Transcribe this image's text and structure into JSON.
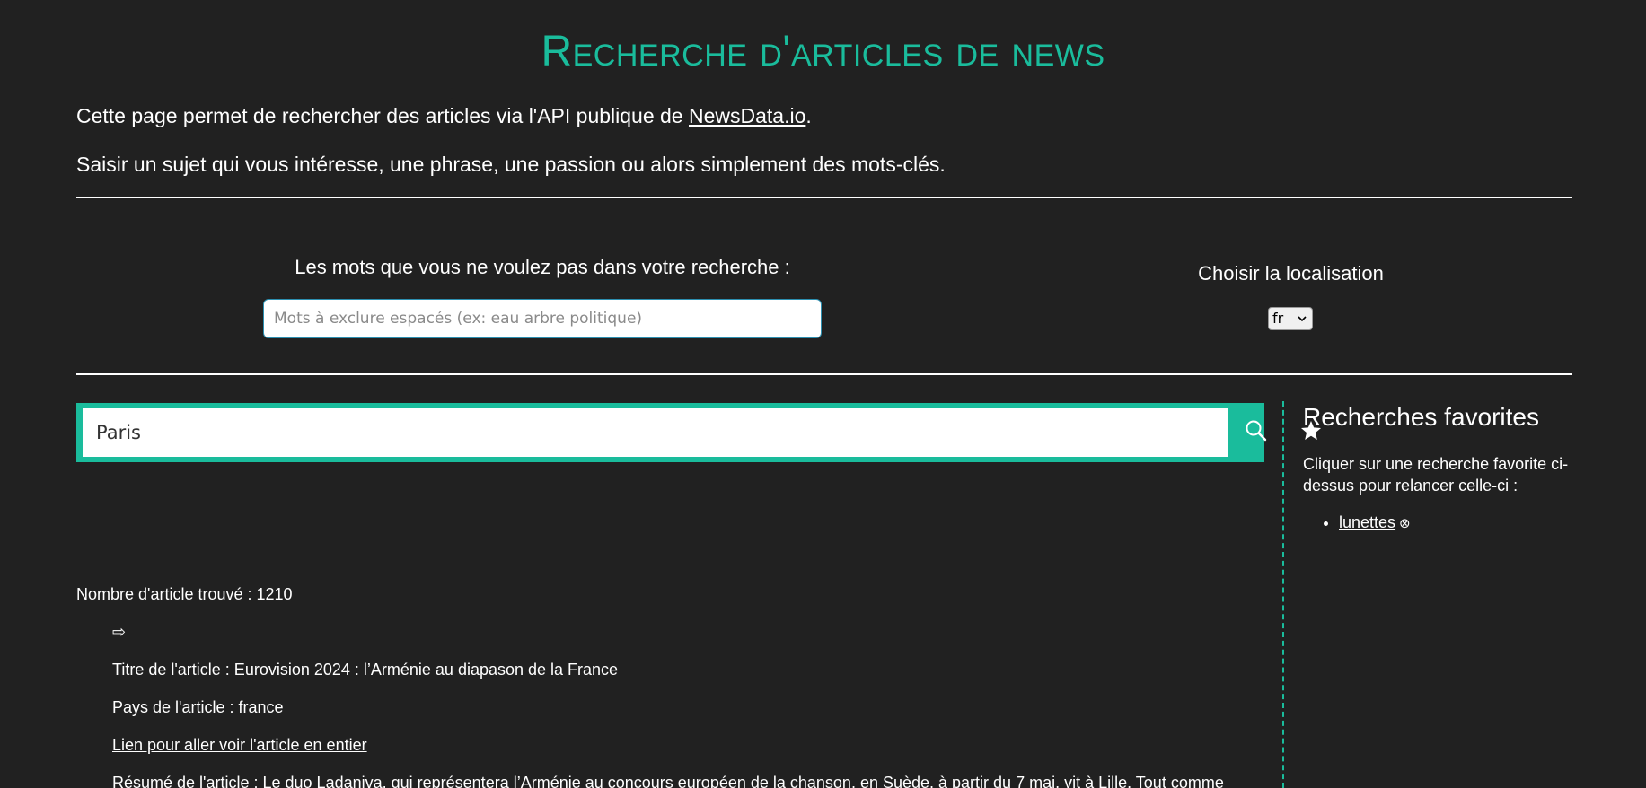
{
  "header": {
    "title": "Recherche d'articles de news"
  },
  "intro": {
    "line1_prefix": "Cette page permet de rechercher des articles via l'API publique de ",
    "line1_link": "NewsData.io",
    "line1_suffix": ".",
    "line2": "Saisir un sujet qui vous intéresse, une phrase, une passion ou alors simplement des mots-clés."
  },
  "filters": {
    "exclude_label": "Les mots que vous ne voulez pas dans votre recherche :",
    "exclude_placeholder": "Mots à exclure espacés (ex: eau arbre politique)",
    "exclude_value": "",
    "location_label": "Choisir la localisation",
    "location_value": "fr"
  },
  "search": {
    "value": "Paris",
    "search_icon": "search-icon",
    "favorite_icon": "star-icon"
  },
  "results": {
    "count_label": "Nombre d'article trouvé : 1210",
    "articles": [
      {
        "arrow": "⇨",
        "title": "Titre de l'article : Eurovision 2024 : l’Arménie au diapason de la France",
        "country": "Pays de l'article : france",
        "link_label": "Lien pour aller voir l'article en entier",
        "summary": "Résumé de l'article : Le duo Ladaniva, qui représentera l’Arménie au concours européen de la chanson, en Suède, à partir du 7 mai, vit à Lille. Tout comme"
      }
    ]
  },
  "favorites": {
    "title": "Recherches favorites",
    "description": "Cliquer sur une recherche favorite ci-dessus pour relancer celle-ci :",
    "items": [
      {
        "label": "lunettes",
        "remove_glyph": "⊗"
      }
    ]
  },
  "colors": {
    "accent": "#1abc9c",
    "background": "#212121",
    "text": "#ffffff"
  }
}
